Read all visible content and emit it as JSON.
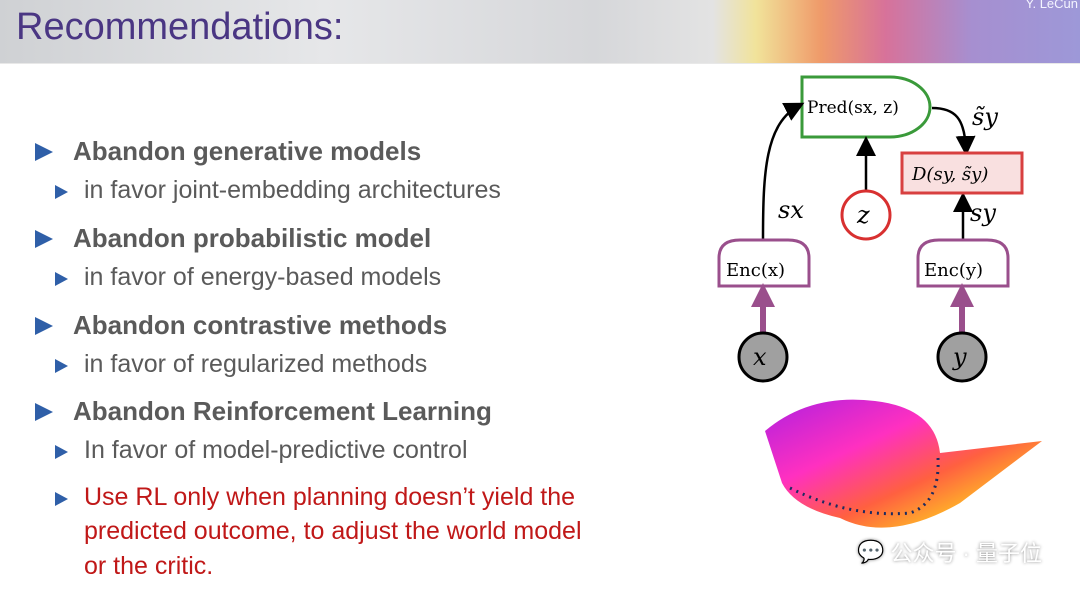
{
  "header": {
    "title": "Recommendations:",
    "author": "Y. LeCun"
  },
  "bullets": [
    {
      "label": "Abandon generative models",
      "sub": [
        {
          "label": "in favor joint-embedding architectures"
        }
      ]
    },
    {
      "label": "Abandon probabilistic model",
      "sub": [
        {
          "label": "in favor of energy-based models"
        }
      ]
    },
    {
      "label": "Abandon contrastive methods",
      "sub": [
        {
          "label": "in favor of regularized methods"
        }
      ]
    },
    {
      "label": "Abandon Reinforcement Learning",
      "sub": [
        {
          "label": "In favor of model-predictive control"
        },
        {
          "lines": [
            "Use RL only when planning doesn’t yield the",
            "predicted outcome, to adjust the world model",
            "or the critic."
          ]
        }
      ]
    }
  ],
  "diagram": {
    "pred": "Pred(sx, z)",
    "enc_x": "Enc(x)",
    "enc_y": "Enc(y)",
    "d": "D(sy, s̃y)",
    "sx": "sx",
    "sy": "sy",
    "sy_tilde": "s̃y",
    "z": "z",
    "x": "x",
    "y": "y"
  },
  "watermark": "公众号 · 量子位",
  "colors": {
    "title": "#4a3683",
    "bullet": "#2f5fa8",
    "red": "#c01818",
    "pred": "#3a9a3a",
    "enc": "#9a4f8c",
    "d": "#d84040"
  }
}
